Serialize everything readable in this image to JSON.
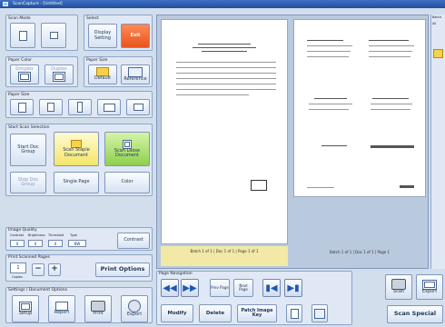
{
  "title": "ScanCapture - [Untitled]",
  "scan_mode": {
    "label": "Scan Mode",
    "mode_label": "Mode",
    "option_a": "",
    "option_b": ""
  },
  "display_group": {
    "label": "Select",
    "display_label": "Display Setting",
    "exit_label": "Exit"
  },
  "paper_color": {
    "label": "Paper Color",
    "opt1": "Simplex",
    "opt2": "Duplex"
  },
  "paper_size": {
    "label": "Paper Size",
    "opt1": "Default",
    "opt2": "Reference"
  },
  "paper_size2": {
    "label": "Paper Size"
  },
  "start_scan": {
    "label": "Start Scan Selection",
    "start_doc_group": "Start Doc Group",
    "scan_staple": "Scan Staple Document",
    "scan_loose": "Scan Loose Document",
    "stop_doc_group": "Stop Doc Group",
    "single_page": "Single Page",
    "color": "Color"
  },
  "image_quality": {
    "label": "Image Quality",
    "col_labels": [
      "Contrast",
      "Brightness",
      "Threshold",
      "Type"
    ],
    "values": [
      "0",
      "0",
      "0",
      "BW"
    ],
    "contrast_label": "Contrast"
  },
  "print_settings": {
    "label": "Print Scanned Pages",
    "count": "1",
    "copies_label": "Copies",
    "minus": "−",
    "plus": "+",
    "print_options": "Print Options"
  },
  "settings": {
    "label": "Settings / Document Options",
    "items": [
      "Setup",
      "Report",
      "Print",
      "Export"
    ]
  },
  "viewer": {
    "caption_left": "Batch 1 of 1 | Doc 1 of 1 | Page 1 of 1",
    "caption_right": "Batch 1 of 1 | Doc 1 of 1 | Page 1"
  },
  "page_nav": {
    "label": "Page Navigation",
    "prev_page": "Prev Page",
    "next_page": "Next Page",
    "modify": "Modify",
    "delete": "Delete",
    "patch_key": "Patch Image Key",
    "scan_special": "Scan Special",
    "scan_btn": "Scan",
    "export_btn": "Export"
  },
  "side": {
    "label": "Batch",
    "tab": "All"
  }
}
